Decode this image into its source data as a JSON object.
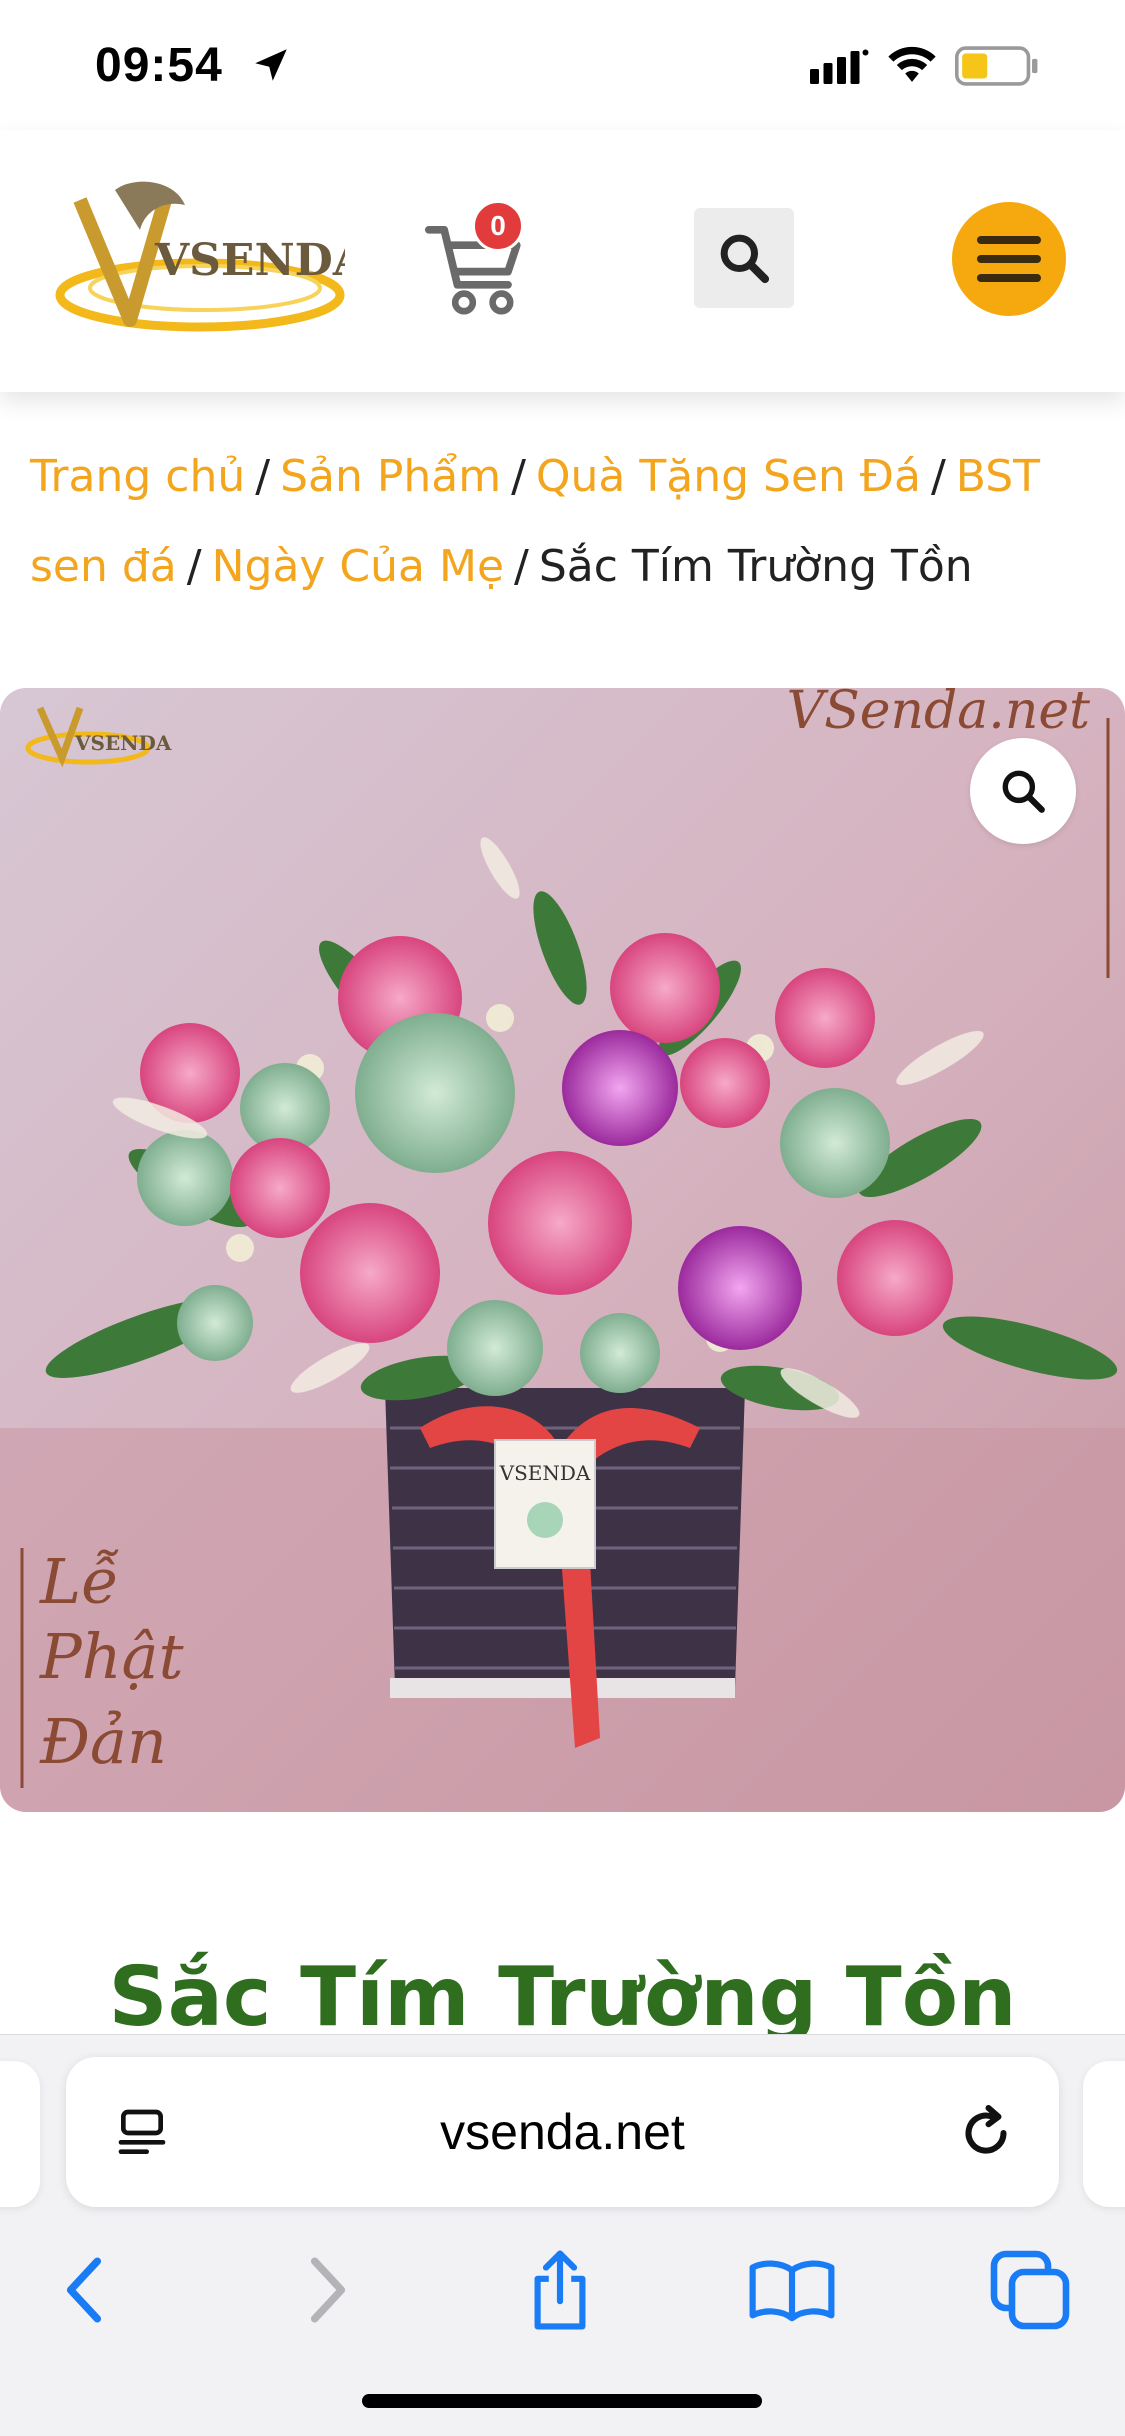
{
  "status_bar": {
    "time": "09:54"
  },
  "header": {
    "logo_alt": "VSENDA",
    "cart_count": "0"
  },
  "breadcrumb": {
    "items": [
      "Trang chủ",
      "Sản Phẩm",
      "Quà Tặng Sen Đá",
      "BST sen đá",
      "Ngày Của Mẹ"
    ],
    "current": "Sắc Tím Trường Tồn",
    "separator": "/"
  },
  "product_image": {
    "watermark_top_right": "VSenda.net",
    "watermark_bottom_left": [
      "Lễ",
      "Phật",
      "Đản"
    ],
    "tag_text": "VSENDA",
    "logo_text": "VSENDA"
  },
  "product": {
    "title": "Sắc Tím Trường Tồn"
  },
  "browser": {
    "url": "vsenda.net"
  },
  "colors": {
    "accent_orange": "#f3a51d",
    "title_green": "#2f6e1e",
    "menu_yellow": "#f5a90e",
    "badge_red": "#e23b3b",
    "safari_blue": "#1a7cf5"
  }
}
